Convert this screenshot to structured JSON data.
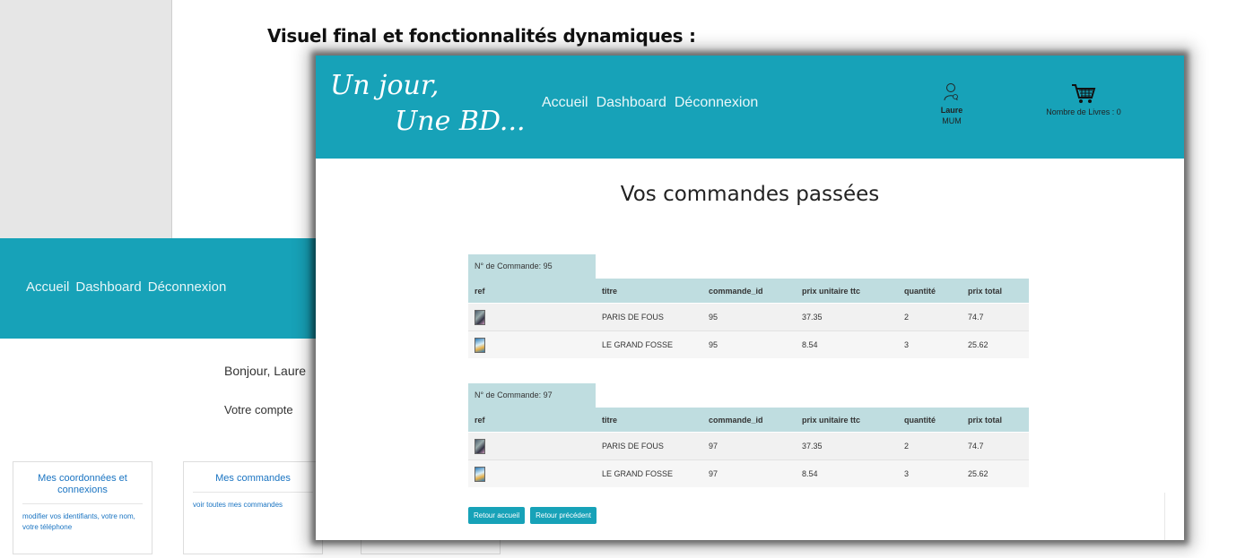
{
  "slide_title": "Visuel final et fonctionnalités dynamiques :",
  "background": {
    "nav": [
      "Accueil",
      "Dashboard",
      "Déconnexion"
    ],
    "greeting": "Bonjour, Laure",
    "account": "Votre compte",
    "cards": [
      {
        "title": "Mes coordonnées et connexions",
        "link": "modifier vos identifiants, votre nom, votre téléphone"
      },
      {
        "title": "Mes commandes",
        "link": "voir toutes mes commandes"
      }
    ]
  },
  "header": {
    "logo_line1": "Un jour,",
    "logo_line2": "Une BD...",
    "nav": [
      "Accueil",
      "Dashboard",
      "Déconnexion"
    ],
    "user_first": "Laure",
    "user_last": "MUM",
    "cart_label": "Nombre de Livres : 0"
  },
  "page_title": "Vos commandes passées",
  "columns": [
    "ref",
    "titre",
    "commande_id",
    "prix unitaire ttc",
    "quantité",
    "prix total"
  ],
  "orders": [
    {
      "label": "N° de Commande: 95",
      "rows": [
        {
          "cover": "cover-paris-de-fous",
          "titre": "PARIS DE FOUS",
          "commande_id": "95",
          "prix_unitaire": "37.35",
          "quantite": "2",
          "prix_total": "74.7"
        },
        {
          "cover": "cover-le-grand-fosse",
          "titre": "LE GRAND FOSSE",
          "commande_id": "95",
          "prix_unitaire": "8.54",
          "quantite": "3",
          "prix_total": "25.62"
        }
      ]
    },
    {
      "label": "N° de Commande: 97",
      "rows": [
        {
          "cover": "cover-paris-de-fous",
          "titre": "PARIS DE FOUS",
          "commande_id": "97",
          "prix_unitaire": "37.35",
          "quantite": "2",
          "prix_total": "74.7"
        },
        {
          "cover": "cover-le-grand-fosse",
          "titre": "LE GRAND FOSSE",
          "commande_id": "97",
          "prix_unitaire": "8.54",
          "quantite": "3",
          "prix_total": "25.62"
        }
      ]
    }
  ],
  "buttons": {
    "home": "Retour accueil",
    "back": "Retour précédent"
  },
  "colors": {
    "accent": "#17a2b8",
    "table_header": "#bfdde0",
    "link": "#1a74c2"
  }
}
